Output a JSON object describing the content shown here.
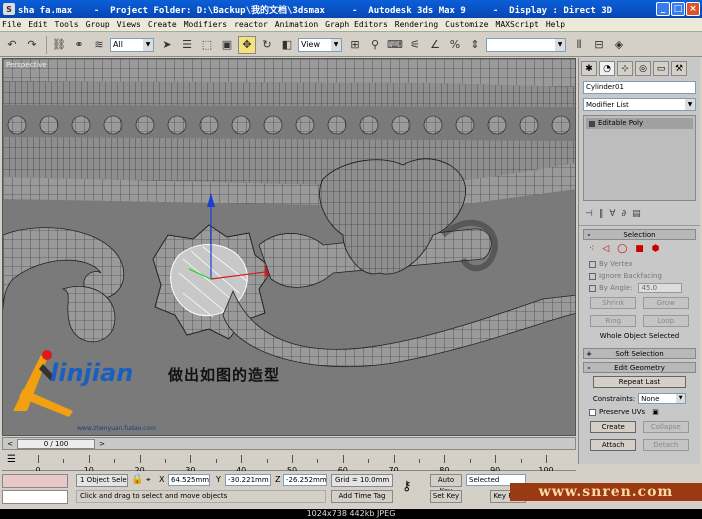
{
  "window": {
    "title": "sha fa.max    -  Project Folder: D:\\Backup\\我的文档\\3dsmax     -  Autodesk 3ds Max 9     -  Display : Direct 3D",
    "icon_letter": "S",
    "buttons": {
      "minimize": "_",
      "maximize": "□",
      "close": "×"
    }
  },
  "menu": [
    "File",
    "Edit",
    "Tools",
    "Group",
    "Views",
    "Create",
    "Modifiers",
    "reactor",
    "Animation",
    "Graph Editors",
    "Rendering",
    "Customize",
    "MAXScript",
    "Help"
  ],
  "toolbar": {
    "selection_filter": "All",
    "reference_coord": "View"
  },
  "viewport": {
    "label": "Perspective",
    "overlay_text": "做出如图的造型",
    "logo_name": "linjian",
    "logo_url": "www.zhenyuan.fudao.com"
  },
  "command_panel": {
    "object_name": "Cylinder01",
    "modifier_list": "Modifier List",
    "stack_items": [
      "Editable Poly"
    ],
    "selection": {
      "title": "Selection",
      "by_vertex": "By Vertex",
      "ignore_backfacing": "Ignore Backfacing",
      "by_angle": "By Angle:",
      "by_angle_value": "45.0",
      "shrink": "Shrink",
      "grow": "Grow",
      "ring": "Ring",
      "loop": "Loop",
      "status": "Whole Object Selected"
    },
    "soft_selection": {
      "title": "Soft Selection"
    },
    "edit_geometry": {
      "title": "Edit Geometry",
      "repeat_last": "Repeat Last",
      "constraints_label": "Constraints:",
      "constraints_value": "None",
      "preserve_uvs": "Preserve UVs",
      "create": "Create",
      "collapse": "Collapse",
      "attach": "Attach",
      "detach": "Detach"
    }
  },
  "timeline": {
    "slider": "0 / 100",
    "ticks": [
      "0",
      "10",
      "20",
      "30",
      "40",
      "50",
      "60",
      "70",
      "80",
      "90",
      "100"
    ]
  },
  "status": {
    "selection": "1 Object Sele",
    "x_label": "X",
    "x_value": "64.525mm",
    "y_label": "Y",
    "y_value": "-30.221mm",
    "z_label": "Z",
    "z_value": "-26.252mm",
    "grid": "Grid = 10.0mm",
    "prompt": "Click and drag to select and move objects",
    "add_time_tag": "Add Time Tag",
    "auto_key": "Auto Key",
    "auto_key_mode": "Selected",
    "set_key": "Set Key",
    "key_filters": "Key Filte"
  },
  "watermark": "www.snren.com",
  "caption": "1024x738  442kb  JPEG"
}
